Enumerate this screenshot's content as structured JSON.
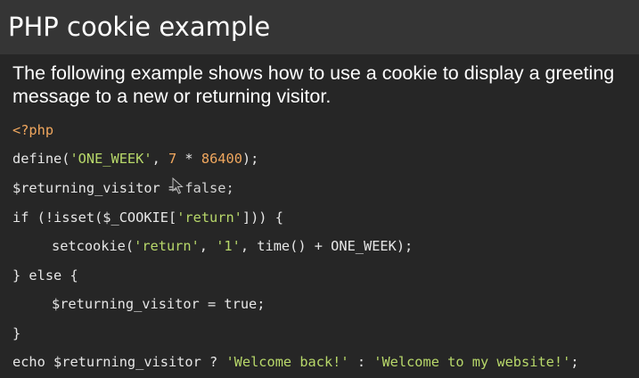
{
  "page": {
    "title": "PHP cookie example",
    "description": "The following example shows how to use a cookie to display a greeting message to a new or returning visitor."
  },
  "code": {
    "l1": [
      "<?php"
    ],
    "l2": [
      "define(",
      "'ONE_WEEK'",
      ", ",
      "7",
      " * ",
      "86400",
      ");"
    ],
    "l3": [
      "$returning_visitor ",
      "= false;"
    ],
    "l4": [
      "if (!isset($_COOKIE[",
      "'return'",
      "])) {"
    ],
    "l5": [
      "setcookie(",
      "'return'",
      ", ",
      "'1'",
      ", time() + ONE_WEEK);"
    ],
    "l6": [
      "} else {"
    ],
    "l7": [
      "$returning_visitor = true;"
    ],
    "l8": [
      "}"
    ],
    "l9": [
      "echo $returning_visitor ? ",
      "'Welcome back!'",
      " : ",
      "'Welcome to my website!'",
      ";"
    ]
  },
  "colors": {
    "background": "#262626",
    "title_band": "#353535",
    "text": "#ffffff",
    "code_text": "#e6e6e6",
    "keyword_orange": "#f0a75e",
    "string_green": "#b8d86a"
  },
  "icons": {
    "cursor": "mouse-pointer-icon"
  }
}
